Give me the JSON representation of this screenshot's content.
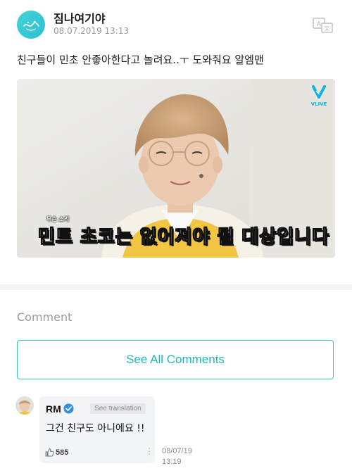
{
  "post": {
    "author": "짐나여기야",
    "timestamp": "08.07.2019 13:13",
    "text": "친구들이 민초 안좋아한다고 놀려요..ㅜ 도와줘요 알엠맨",
    "image": {
      "badge_text": "VLIVE",
      "caption_small": "무슨 소리",
      "caption_main": "민트 초코는 없어져야 될 대상입니다"
    },
    "icons": {
      "avatar": "bunny-logo-icon",
      "translate": "translate-icon"
    }
  },
  "comments": {
    "heading": "Comment",
    "see_all_label": "See All Comments",
    "items": [
      {
        "author": "RM",
        "verified": true,
        "see_translation_label": "See translation",
        "text": "그건 친구도 아니에요 !!",
        "likes": "585",
        "date": "08/07/19",
        "time": "13:19"
      }
    ]
  },
  "colors": {
    "accent": "#23b9b3",
    "avatar": "#2dbfcf",
    "verified": "#2f8fe3",
    "vlive": "#0fb5d6"
  }
}
